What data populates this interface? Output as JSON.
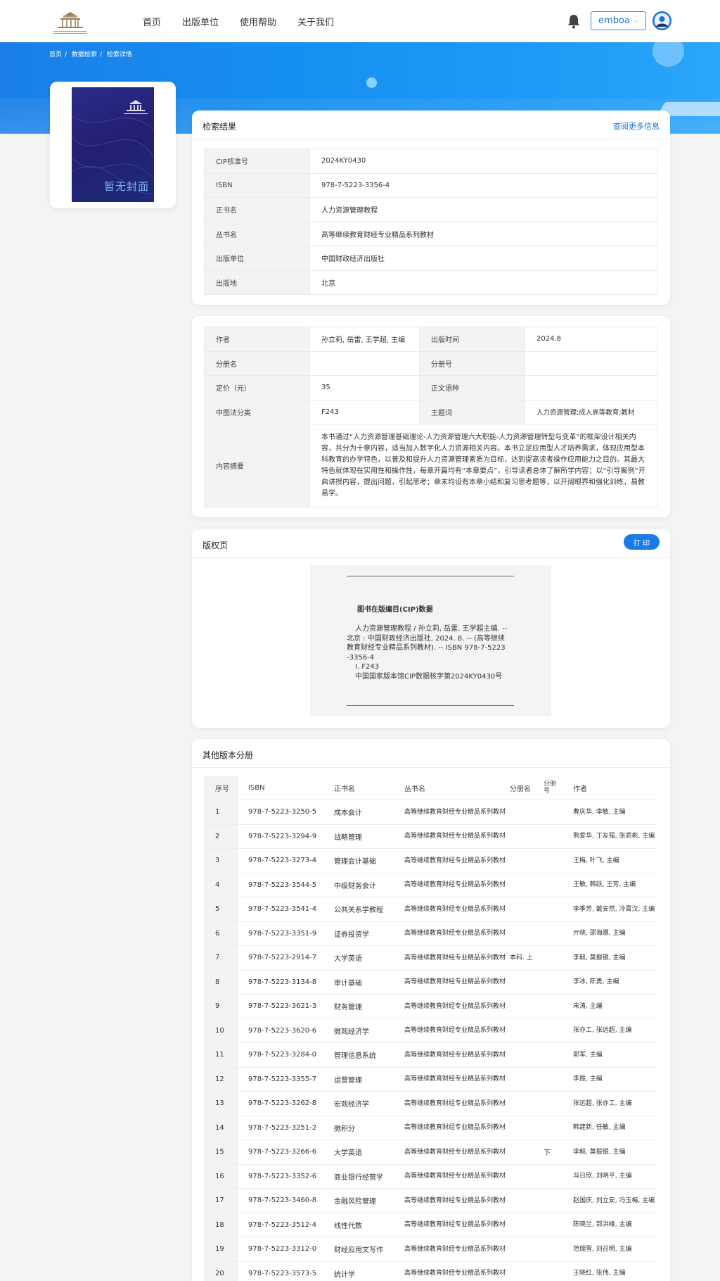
{
  "header": {
    "nav": [
      "首页",
      "出版单位",
      "使用帮助",
      "关于我们"
    ],
    "user": "emboa"
  },
  "breadcrumb": [
    "首页",
    "数据检索",
    "检索详情"
  ],
  "cover": {
    "text": "暂无封面"
  },
  "result": {
    "title": "检索结果",
    "more": "查阅更多信息",
    "rows": [
      {
        "k": "CIP核准号",
        "v": "2024KY0430"
      },
      {
        "k": "ISBN",
        "v": "978-7-5223-3356-4"
      },
      {
        "k": "正书名",
        "v": "人力资源管理教程"
      },
      {
        "k": "丛书名",
        "v": "高等继续教育财经专业精品系列教材"
      },
      {
        "k": "出版单位",
        "v": "中国财政经济出版社"
      },
      {
        "k": "出版地",
        "v": "北京"
      }
    ]
  },
  "detail": {
    "author_k": "作者",
    "author_v": "孙立莉, 岳雷, 王学超, 主编",
    "pubtime_k": "出版时间",
    "pubtime_v": "2024.8",
    "volname_k": "分册名",
    "volname_v": "",
    "volno_k": "分册号",
    "volno_v": "",
    "price_k": "定价（元）",
    "price_v": "35",
    "lang_k": "正文语种",
    "lang_v": "",
    "clc_k": "中图法分类",
    "clc_v": "F243",
    "subject_k": "主题词",
    "subject_v": "人力资源管理;成人高等教育;教材",
    "summary_k": "内容摘要",
    "summary_v": "本书通过“人力资源管理基础理论-人力资源管理六大职能-人力资源管理转型与变革”的框架设计相关内容，共分为十章内容，适当加入数字化人力资源相关内容。本书立足应用型人才培养需求，体现应用型本科教育的办学特色，以普及和提升人力资源管理素质为目标，达到提高读者操作应用能力之目的。其最大特色就体现在实用性和操作性，每章开篇均有“本章要点”，引导读者总体了解所学内容；以“引导案例”开启讲授内容，提出问题，引起思考；章末均设有本章小结和复习思考题等，以开阔眼界和强化训练，易教易学。"
  },
  "copyright": {
    "title": "版权页",
    "print": "打 印",
    "cip_title": "图书在版编目(CIP)数据",
    "cip_line1": "人力资源管理教程 / 孙立莉, 岳雷, 王学超主编. --",
    "cip_line2": "北京 : 中国财政经济出版社, 2024. 8. -- (高等继续",
    "cip_line3": "教育财经专业精品系列教材). -- ISBN 978-7-5223",
    "cip_line4": "-3356-4",
    "cip_line5": "Ⅰ. F243",
    "cip_line6": "中国国家版本馆CIP数据核字第2024KY0430号"
  },
  "editions": {
    "title": "其他版本分册",
    "headers": [
      "序号",
      "ISBN",
      "正书名",
      "丛书名",
      "分册名",
      "分册号",
      "作者"
    ],
    "rows": [
      {
        "n": "1",
        "isbn": "978-7-5223-3250-5",
        "name": "成本会计",
        "series": "高等继续教育财经专业精品系列教材",
        "vol": "",
        "no": "",
        "author": "曹庆华, 李敏, 主编"
      },
      {
        "n": "2",
        "isbn": "978-7-5223-3294-9",
        "name": "战略管理",
        "series": "高等继续教育财经专业精品系列教材",
        "vol": "",
        "no": "",
        "author": "熊爱华, 丁友强, 张质彬, 主编"
      },
      {
        "n": "3",
        "isbn": "978-7-5223-3273-4",
        "name": "管理会计基础",
        "series": "高等继续教育财经专业精品系列教材",
        "vol": "",
        "no": "",
        "author": "王梅, 叶飞, 主编"
      },
      {
        "n": "4",
        "isbn": "978-7-5223-3544-5",
        "name": "中级财务会计",
        "series": "高等继续教育财经专业精品系列教材",
        "vol": "",
        "no": "",
        "author": "王敏, 韩跃, 王芳, 主编"
      },
      {
        "n": "5",
        "isbn": "978-7-5223-3541-4",
        "name": "公共关系学教程",
        "series": "高等继续教育财经专业精品系列教材",
        "vol": "",
        "no": "",
        "author": "李季芳, 戴安然, 冷霄汉, 主编"
      },
      {
        "n": "6",
        "isbn": "978-7-5223-3351-9",
        "name": "证券投资学",
        "series": "高等继续教育财经专业精品系列教材",
        "vol": "",
        "no": "",
        "author": "亓晓, 邵海娜, 主编"
      },
      {
        "n": "7",
        "isbn": "978-7-5223-2914-7",
        "name": "大学英语",
        "series": "高等继续教育财经专业精品系列教材",
        "vol": "本科. 上",
        "no": "",
        "author": "李毅, 莫振银, 主编"
      },
      {
        "n": "8",
        "isbn": "978-7-5223-3134-8",
        "name": "审计基础",
        "series": "高等继续教育财经专业精品系列教材",
        "vol": "",
        "no": "",
        "author": "李冰, 陈勇, 主编"
      },
      {
        "n": "9",
        "isbn": "978-7-5223-3621-3",
        "name": "财务管理",
        "series": "高等继续教育财经专业精品系列教材",
        "vol": "",
        "no": "",
        "author": "宋涛, 主编"
      },
      {
        "n": "10",
        "isbn": "978-7-5223-3620-6",
        "name": "微观经济学",
        "series": "高等继续教育财经专业精品系列教材",
        "vol": "",
        "no": "",
        "author": "张亦工, 张远超, 主编"
      },
      {
        "n": "11",
        "isbn": "978-7-5223-3284-0",
        "name": "管理信息系统",
        "series": "高等继续教育财经专业精品系列教材",
        "vol": "",
        "no": "",
        "author": "郭军, 主编"
      },
      {
        "n": "12",
        "isbn": "978-7-5223-3355-7",
        "name": "运营管理",
        "series": "高等继续教育财经专业精品系列教材",
        "vol": "",
        "no": "",
        "author": "李振, 主编"
      },
      {
        "n": "13",
        "isbn": "978-7-5223-3262-8",
        "name": "宏观经济学",
        "series": "高等继续教育财经专业精品系列教材",
        "vol": "",
        "no": "",
        "author": "张远超, 张亦工, 主编"
      },
      {
        "n": "14",
        "isbn": "978-7-5223-3251-2",
        "name": "微积分",
        "series": "高等继续教育财经专业精品系列教材",
        "vol": "",
        "no": "",
        "author": "韩建新, 任敏, 主编"
      },
      {
        "n": "15",
        "isbn": "978-7-5223-3266-6",
        "name": "大学英语",
        "series": "高等继续教育财经专业精品系列教材",
        "vol": "",
        "no": "下",
        "author": "李毅, 莫振银, 主编"
      },
      {
        "n": "16",
        "isbn": "978-7-5223-3352-6",
        "name": "商业银行经营学",
        "series": "高等继续教育财经专业精品系列教材",
        "vol": "",
        "no": "",
        "author": "冯日欣, 刘晓平, 主编"
      },
      {
        "n": "17",
        "isbn": "978-7-5223-3460-8",
        "name": "金融风险管理",
        "series": "高等继续教育财经专业精品系列教材",
        "vol": "",
        "no": "",
        "author": "赵国庆, 刘立安, 冯玉梅, 主编"
      },
      {
        "n": "18",
        "isbn": "978-7-5223-3512-4",
        "name": "线性代数",
        "series": "高等继续教育财经专业精品系列教材",
        "vol": "",
        "no": "",
        "author": "陈晓兰, 郭洪峰, 主编"
      },
      {
        "n": "19",
        "isbn": "978-7-5223-3312-0",
        "name": "财经应用文写作",
        "series": "高等继续教育财经专业精品系列教材",
        "vol": "",
        "no": "",
        "author": "范瑞雪, 刘召明, 主编"
      },
      {
        "n": "20",
        "isbn": "978-7-5223-3573-5",
        "name": "统计学",
        "series": "高等继续教育财经专业精品系列教材",
        "vol": "",
        "no": "",
        "author": "王晓红, 张伟, 主编"
      }
    ]
  }
}
